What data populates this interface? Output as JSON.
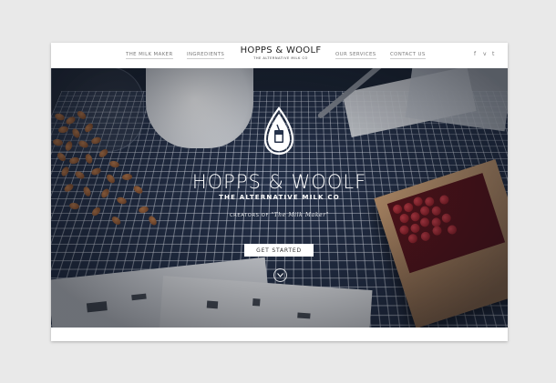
{
  "nav": {
    "left_links": [
      "THE MILK MAKER",
      "INGREDIENTS"
    ],
    "right_links": [
      "OUR SERVICES",
      "CONTACT US"
    ],
    "logo_name": "HOPPS & WOOLF",
    "logo_tagline": "THE ALTERNATIVE MILK CO",
    "social": {
      "facebook": "f",
      "vimeo": "v",
      "twitter": "t"
    }
  },
  "hero": {
    "brand": "HOPPS & WOOLF",
    "tagline": "THE ALTERNATIVE MILK CO",
    "creators_prefix": "CREATORS OF",
    "creators_product": "\"The Milk Maker\"",
    "cta_label": "GET STARTED"
  },
  "colors": {
    "background": "#e9e9e9",
    "hero_tint": "#253149",
    "cta_bg": "#ffffff"
  }
}
